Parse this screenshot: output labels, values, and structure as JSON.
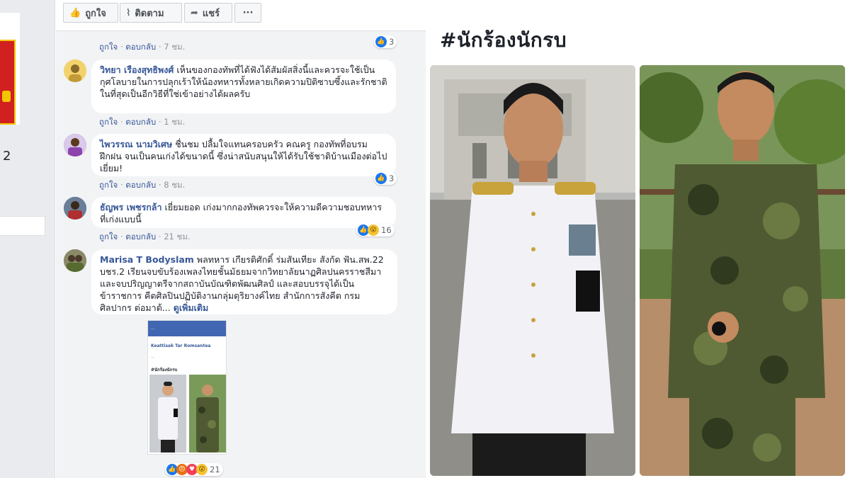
{
  "left_strip": {
    "visible_number": "2"
  },
  "actions": {
    "like_label": "ถูกใจ",
    "follow_label": "ติดตาม",
    "share_label": "แชร์",
    "more_label": "···"
  },
  "comment_actions": {
    "like": "ถูกใจ",
    "reply": "ตอบกลับ",
    "sep": "·"
  },
  "comments": [
    {
      "author": "",
      "text": "",
      "time": "7 ชม.",
      "reactions": "3"
    },
    {
      "author": "วิทยา เรืองสุทธิพงศ์",
      "text": "เห็นของกองทัพที่ได้ฟังได้สัมผัสสิ่งนี้และควรจะใช้เป็นกุศโลบายในการปลุกเร้าให้น้องทหารทั้งหลายเกิดความปิติซาบซึ้งและรักชาติในที่สุดเป็นอีกวิธีที่ใช่เข้าอย่างได้ผลครับ",
      "time": "1 ชม.",
      "reactions": ""
    },
    {
      "author": "ไพวรรณ นามวิเศษ",
      "text": "ชื่นชม ปลื้มใจแทนครอบครัว คณครู กองทัพที่อบรม ฝึกฝน จนเป็นคนเก่งได้ขนาดนี้ ซึ่งน่าสนับสนุนให้ได้รับใช้ชาติบ้านเมืองต่อไป เยี่ยม!",
      "time": "8 ชม.",
      "reactions": "3"
    },
    {
      "author": "ธัญพร เพชรกล้า",
      "text": "เยี่ยมยอด เก่งมากกองทัพควรจะให้ความดีความชอบทหารที่เก่งแบบนี้",
      "time": "21 ชม.",
      "reactions": "16"
    },
    {
      "author": "Marisa T Bodyslam",
      "text": "พลทหาร เกียรติศักดิ์ ร่มสันเทียะ สังกัด ฟัน.สพ.22 บชร.2 เรียนจบขับร้องเพลงไทยชั้นมัธยมจากวิทยาลัยนาฏศิลปนครราชสีมา และจบปริญญาตรีจากสถาบันบัณฑิตพัฒนศิลป์ และสอบบรรจุได้เป็นข้าราชการ คีตศิลปินปฏิบัติงานกลุ่มดุริยางค์ไทย สำนักการสังคีต กรมศิลปากร ต่อมาต้...",
      "see_more": "ดูเพิ่มเติม",
      "time": "",
      "reactions": "21"
    }
  ],
  "attachment": {
    "header": "...",
    "user": "Keattisak Tar Romsantea",
    "caption": "...",
    "tag": "#นักร้องนักรบ"
  },
  "right_panel": {
    "hashtag": "#นักร้องนักรบ"
  }
}
